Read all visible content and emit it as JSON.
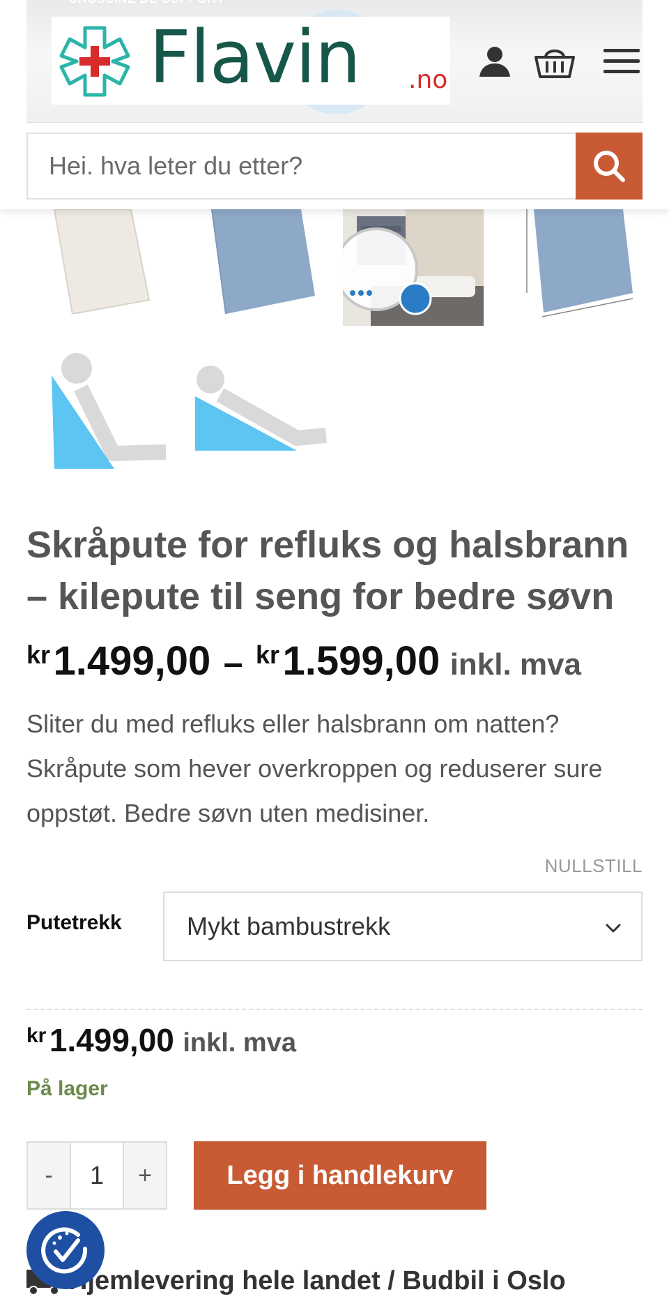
{
  "header": {
    "banner_text": "CRUSSINE DE SUPPORT",
    "logo": {
      "word": "Flavin",
      "tld": ".no"
    },
    "icons": {
      "account": "user-icon",
      "cart": "basket-icon",
      "menu": "hamburger-menu-icon"
    },
    "search": {
      "placeholder": "Hei. hva leter du etter?",
      "button_icon": "search-icon"
    }
  },
  "gallery": {
    "thumbnails": [
      "wedge-pillow-white",
      "wedge-pillow-blue",
      "wedge-pillow-bedroom",
      "wedge-pillow-blue-dimensions",
      "wedge-angle-upright",
      "wedge-angle-reclined"
    ]
  },
  "product": {
    "title": "Skråpute for refluks og halsbrann – kilepute til seng for bedre søvn",
    "price_range": {
      "currency": "kr",
      "min": "1.499,00",
      "separator": "–",
      "max": "1.599,00",
      "vat": "inkl. mva"
    },
    "description": "Sliter du med refluks eller halsbrann om natten? Skråpute som hever overkroppen og reduserer sure oppstøt. Bedre søvn uten medisiner.",
    "variation": {
      "reset_label": "NULLSTILL",
      "label": "Putetrekk",
      "selected": "Mykt bambustrekk"
    },
    "price": {
      "currency": "kr",
      "amount": "1.499,00",
      "vat": "inkl. mva"
    },
    "stock": "På lager",
    "quantity": {
      "minus": "-",
      "value": "1",
      "plus": "+"
    },
    "add_to_cart": "Legg i handlekurv",
    "delivery": "Hjemlevering hele landet / Budbil i Oslo"
  },
  "colors": {
    "accent": "#c85a34",
    "logo_green": "#17574a",
    "logo_red": "#d72b2b",
    "stock_green": "#6b8a4c",
    "accessibility_blue": "#1f4fa3"
  }
}
